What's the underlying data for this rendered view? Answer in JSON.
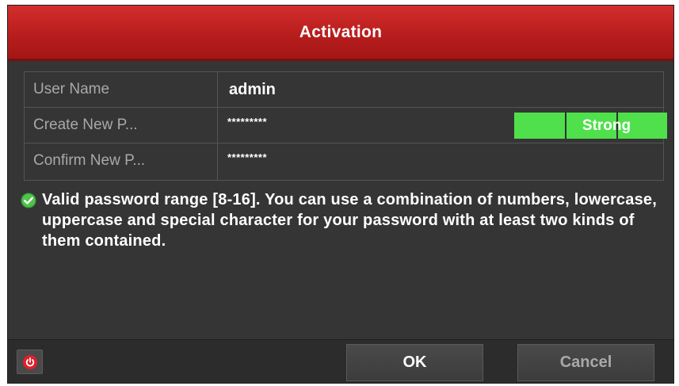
{
  "dialog": {
    "title": "Activation"
  },
  "form": {
    "user_name_label": "User Name",
    "user_name_value": "admin",
    "create_password_label": "Create New P...",
    "create_password_value": "*********",
    "password_strength": "Strong",
    "confirm_password_label": "Confirm New P...",
    "confirm_password_value": "*********"
  },
  "hint": {
    "icon": "check-circle-icon",
    "text": "Valid password range [8-16]. You can use a combination of numbers, lowercase, uppercase and special character for your password with at least two kinds of them contained."
  },
  "footer": {
    "power_icon": "power-icon",
    "ok_label": "OK",
    "cancel_label": "Cancel"
  },
  "colors": {
    "titlebar": "#c0201f",
    "dialog_bg": "#353535",
    "strength_bar": "#4fe04c",
    "power_icon": "#e01f2a"
  }
}
